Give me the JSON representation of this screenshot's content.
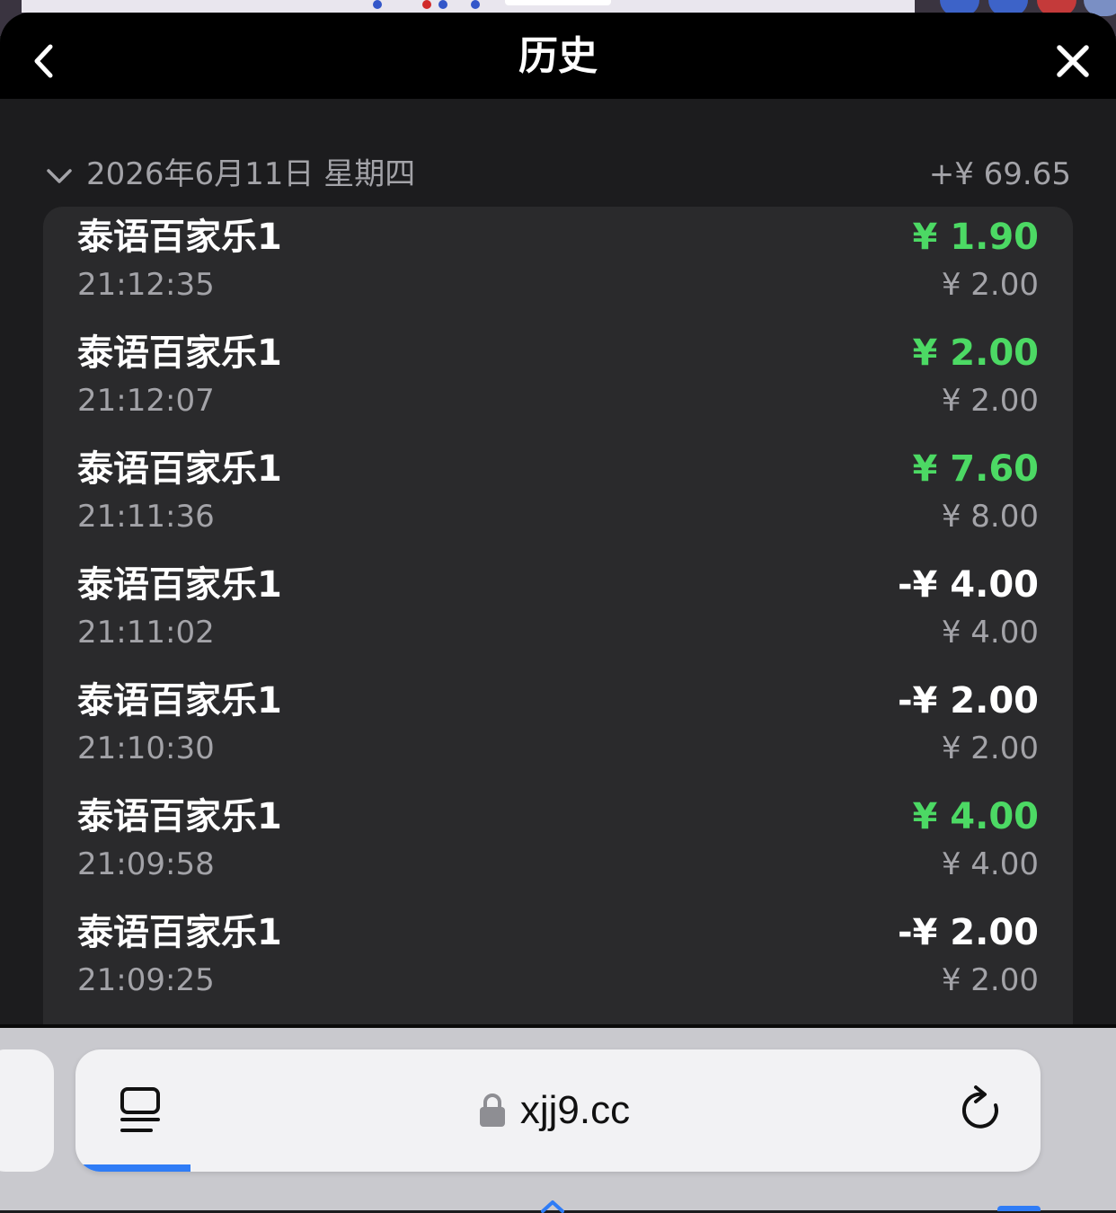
{
  "header": {
    "title": "历史",
    "back_icon": "chevron-left-icon",
    "close_icon": "close-icon"
  },
  "day_group": {
    "date": "2026年6月11日 星期四",
    "total": "+¥ 69.65",
    "chevron_icon": "chevron-down-icon"
  },
  "transactions": [
    {
      "game": "泰语百家乐1",
      "time": "21:12:35",
      "amount": "¥ 1.90",
      "bet": "¥ 2.00",
      "positive": true
    },
    {
      "game": "泰语百家乐1",
      "time": "21:12:07",
      "amount": "¥ 2.00",
      "bet": "¥ 2.00",
      "positive": true
    },
    {
      "game": "泰语百家乐1",
      "time": "21:11:36",
      "amount": "¥ 7.60",
      "bet": "¥ 8.00",
      "positive": true
    },
    {
      "game": "泰语百家乐1",
      "time": "21:11:02",
      "amount": "-¥ 4.00",
      "bet": "¥ 4.00",
      "positive": false
    },
    {
      "game": "泰语百家乐1",
      "time": "21:10:30",
      "amount": "-¥ 2.00",
      "bet": "¥ 2.00",
      "positive": false
    },
    {
      "game": "泰语百家乐1",
      "time": "21:09:58",
      "amount": "¥ 4.00",
      "bet": "¥ 4.00",
      "positive": true
    },
    {
      "game": "泰语百家乐1",
      "time": "21:09:25",
      "amount": "-¥ 2.00",
      "bet": "¥ 2.00",
      "positive": false
    }
  ],
  "colors": {
    "positive": "#4cd964",
    "negative": "#ffffff",
    "progress": "#2f7cf6"
  },
  "browser": {
    "url": "xjj9.cc",
    "tabs_icon": "tab-overview-icon",
    "lock_icon": "lock-icon",
    "reload_icon": "reload-icon"
  }
}
